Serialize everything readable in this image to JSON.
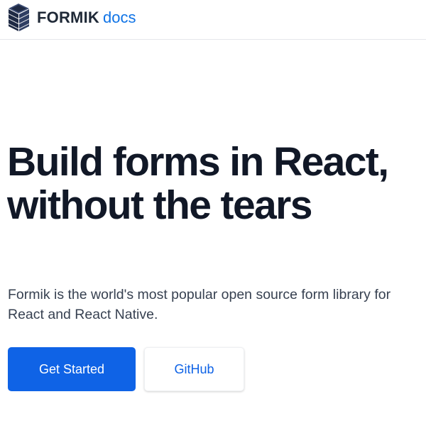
{
  "header": {
    "brand_name": "FORMIK",
    "brand_suffix": "docs",
    "logo_icon": "formik-stacked-blocks-logo",
    "brand_color": "#1f2937",
    "accent_color": "#0f73e6"
  },
  "hero": {
    "title": "Build forms in React, without the tears",
    "subtitle": "Formik is the world's most popular open source form library for React and React Native."
  },
  "actions": {
    "get_started_label": "Get Started",
    "github_label": "GitHub",
    "primary_color": "#0f63e6"
  }
}
